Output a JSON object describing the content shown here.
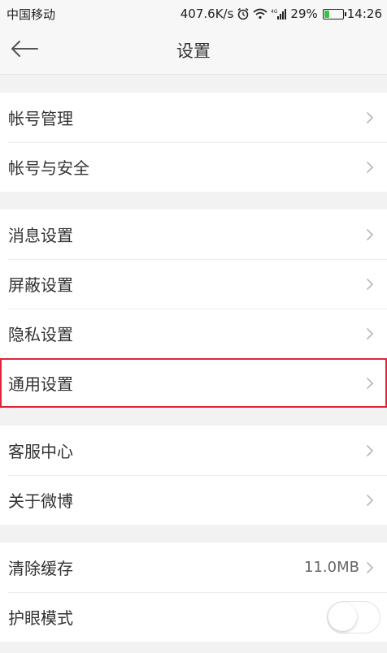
{
  "status_bar": {
    "carrier": "中国移动",
    "speed": "407.6K/s",
    "battery_text": "29%",
    "battery_level": 0.29,
    "time": "14:26",
    "icons": [
      "alarm-icon",
      "wifi-icon",
      "signal-icon",
      "battery-icon"
    ]
  },
  "nav": {
    "title": "设置",
    "back_icon": "back-arrow-icon"
  },
  "groups": [
    {
      "items": [
        {
          "label": "帐号管理"
        },
        {
          "label": "帐号与安全"
        }
      ]
    },
    {
      "items": [
        {
          "label": "消息设置"
        },
        {
          "label": "屏蔽设置"
        },
        {
          "label": "隐私设置"
        },
        {
          "label": "通用设置",
          "highlighted": true
        }
      ]
    },
    {
      "items": [
        {
          "label": "客服中心"
        },
        {
          "label": "关于微博"
        }
      ]
    },
    {
      "items": [
        {
          "label": "清除缓存",
          "value": "11.0MB"
        },
        {
          "label": "护眼模式",
          "toggle": false
        }
      ]
    }
  ],
  "colors": {
    "highlight": "#e0243a",
    "battery_fill": "#39c14a",
    "background": "#f2f2f2"
  }
}
